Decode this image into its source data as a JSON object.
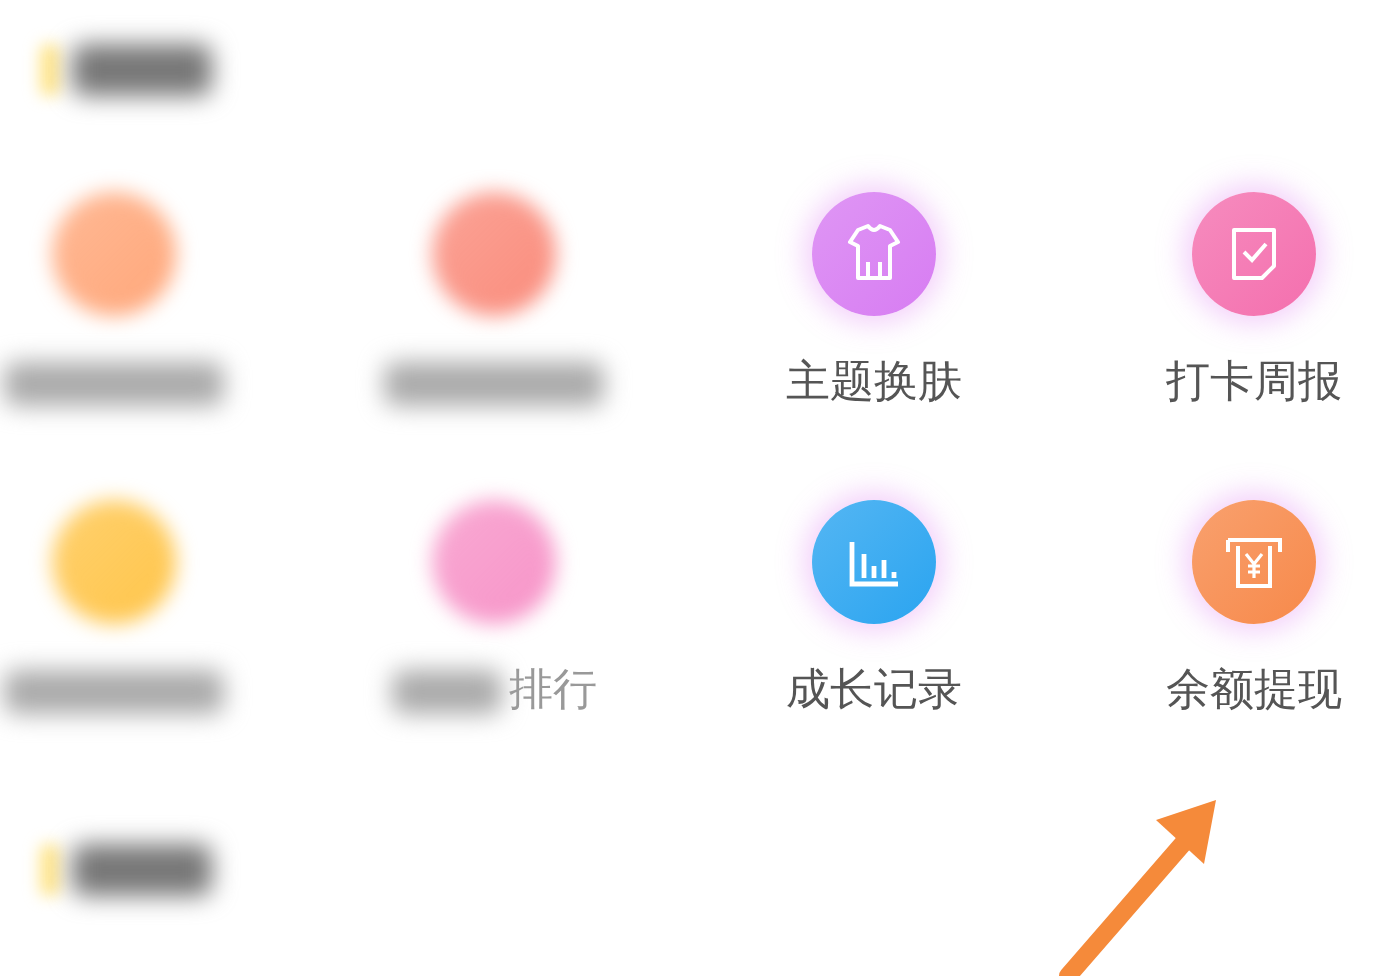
{
  "sections": [
    {
      "blurred": true,
      "items": [
        {
          "blurred": true,
          "color": "#ffa77a",
          "kind": "plain"
        },
        {
          "blurred": true,
          "color": "#fa8c7c",
          "kind": "plain"
        },
        {
          "blurred": false,
          "color": "#d77cf2",
          "kind": "shirt",
          "label": "主题换肤"
        },
        {
          "blurred": false,
          "color": "#f46fae",
          "kind": "check",
          "label": "打卡周报"
        },
        {
          "blurred": true,
          "color": "#ffc54a",
          "kind": "plain"
        },
        {
          "blurred": true,
          "color": "#f794c8",
          "kind": "plain",
          "label": "排行"
        },
        {
          "blurred": false,
          "color": "#2aa4f0",
          "kind": "chart",
          "label": "成长记录"
        },
        {
          "blurred": false,
          "color": "#f7894a",
          "kind": "yen",
          "label": "余额提现"
        }
      ]
    },
    {
      "blurred": true
    }
  ],
  "annotation": {
    "kind": "arrow",
    "color": "#f58a3a"
  }
}
